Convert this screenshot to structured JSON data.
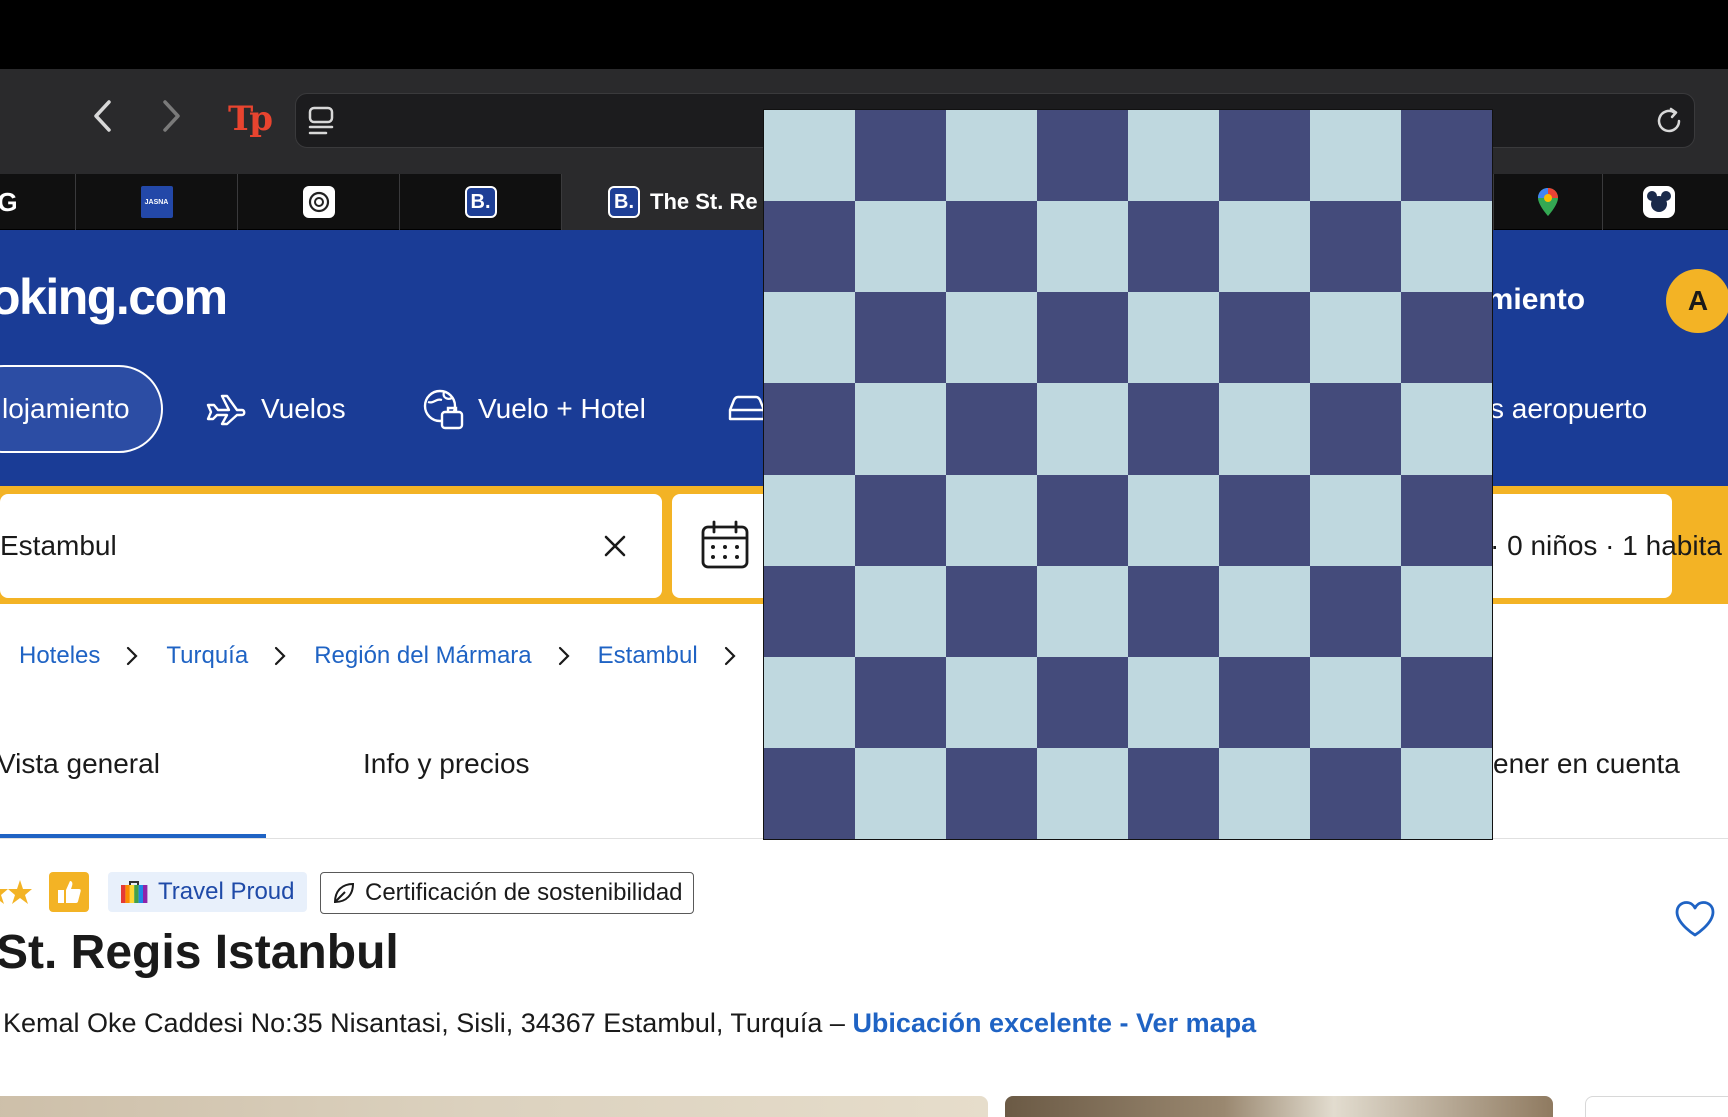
{
  "browser": {
    "extension_label": "Tp",
    "tabs": [
      {
        "icon": "g-favicon-icon",
        "label": ""
      },
      {
        "icon": "jasna-favicon-icon",
        "label": "",
        "favicon_text": "JASNA"
      },
      {
        "icon": "chatgpt-favicon-icon",
        "label": ""
      },
      {
        "icon": "booking-favicon-icon",
        "label": "",
        "favicon_text": "B."
      },
      {
        "icon": "booking-favicon-icon",
        "label": "The St. Re",
        "favicon_text": "B.",
        "active": true
      },
      {
        "icon": "google-maps-favicon-icon",
        "label": ""
      },
      {
        "icon": "disney-favicon-icon",
        "label": ""
      }
    ]
  },
  "header": {
    "logo": "oking.com",
    "register": "amiento",
    "avatar_initial": "A",
    "nav": {
      "stays": "lojamiento",
      "flights": "Vuelos",
      "flight_hotel": "Vuelo + Hotel",
      "airport_taxi": "s aeropuerto"
    }
  },
  "search": {
    "destination": "Estambul",
    "guests": "· 0 niños · 1 habita"
  },
  "breadcrumb": [
    "Hoteles",
    "Turquía",
    "Región del Mármara",
    "Estambul"
  ],
  "property_tabs": {
    "overview": "Vista general",
    "info_prices": "Info y precios",
    "keep_in_mind": "ener en cuenta"
  },
  "property": {
    "badge_travel_proud": "Travel Proud",
    "badge_sustainability": "Certificación de sostenibilidad",
    "name": "St. Regis Istanbul",
    "address": "Kemal Oke Caddesi No:35 Nisantasi, Sisli, 34367 Estambul, Turquía – ",
    "map_link": "Ubicación excelente - Ver mapa"
  },
  "colors": {
    "brand_blue": "#1a3c96",
    "search_yellow": "#f3b325",
    "link_blue": "#1f63c4",
    "checker_light": "#bfd8df",
    "checker_dark": "#444b7b"
  }
}
